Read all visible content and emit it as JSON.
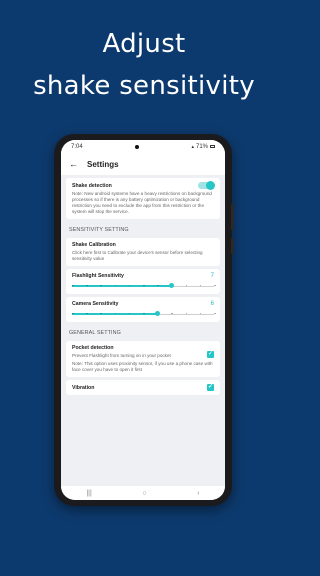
{
  "headline": {
    "line1": "Adjust",
    "line2": "shake sensitivity"
  },
  "status_bar": {
    "time": "7:04",
    "battery": "71%"
  },
  "app_bar": {
    "back_glyph": "←",
    "title": "Settings"
  },
  "shake_detection": {
    "title": "Shake detection",
    "enabled": true,
    "note": "Note: New android systems have a heavy restrictions on background processes so if there is any battery optimization or background restriction you need to exclude the app from this restriction or the system will stop the service."
  },
  "sensitivity_section": {
    "header": "SENSITIVITY SETTING"
  },
  "shake_calibration": {
    "title": "Shake Calibration",
    "desc": "Click here first to Calibrate your device's sensor before selecting sensitivity value"
  },
  "flashlight_sensitivity": {
    "label": "Flashlight Sensitivity",
    "value": "7",
    "level": 7,
    "max": 10
  },
  "camera_sensitivity": {
    "label": "Camera Sensitivity",
    "value": "6",
    "level": 6,
    "max": 10
  },
  "general_section": {
    "header": "GENERAL SETTING"
  },
  "pocket_detection": {
    "title": "Pocket detection",
    "desc": "Prevent Flashlight from turning on in your pocket",
    "note": "Note: This option uses proximity sensor, if you use a phone case with face cover you have to open it first",
    "checked": true
  },
  "vibration": {
    "title": "Vibration",
    "checked": true
  },
  "nav_bar": {
    "recents": "|||",
    "home": "○",
    "back": "‹"
  },
  "colors": {
    "background": "#0d3a6e",
    "accent": "#26c6c6"
  }
}
